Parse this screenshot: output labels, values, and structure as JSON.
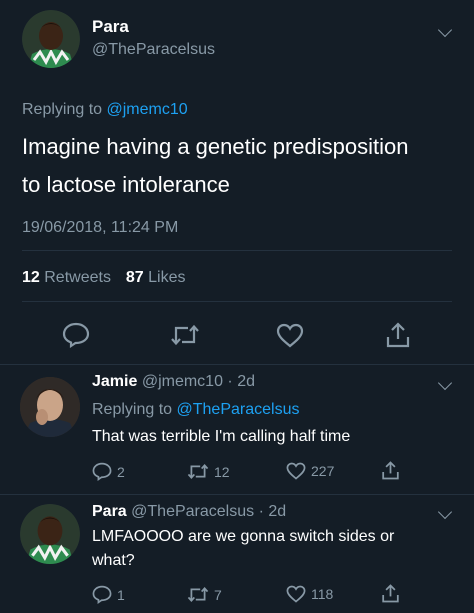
{
  "main_tweet": {
    "name": "Para",
    "handle": "@TheParacelsus",
    "replying_prefix": "Replying to",
    "replying_to": "@jmemc10",
    "text_line1": "Imagine having a genetic predisposition",
    "text_line2": "to lactose intolerance",
    "timestamp": "19/06/2018, 11:24 PM",
    "retweets_count": "12",
    "retweets_label": "Retweets",
    "likes_count": "87",
    "likes_label": "Likes",
    "icons": [
      "reply-icon",
      "retweet-icon",
      "like-icon",
      "share-icon"
    ]
  },
  "reply1": {
    "name": "Jamie",
    "handle_time": "@jmemc10 · 2d",
    "replying_prefix": "Replying to",
    "replying_to": "@TheParacelsus",
    "text": "That was terrible I'm calling half time",
    "reply_count": "2",
    "retweet_count": "12",
    "like_count": "227"
  },
  "reply2": {
    "name": "Para",
    "handle_time": "@TheParacelsus · 2d",
    "text_line1": "LMFAOOOO are we gonna switch sides or",
    "text_line2": "what?",
    "reply_count": "1",
    "retweet_count": "7",
    "like_count": "118"
  },
  "colors": {
    "background": "#141d26",
    "muted": "#8899a6",
    "link": "#1da1f2",
    "divider": "#24313e"
  }
}
